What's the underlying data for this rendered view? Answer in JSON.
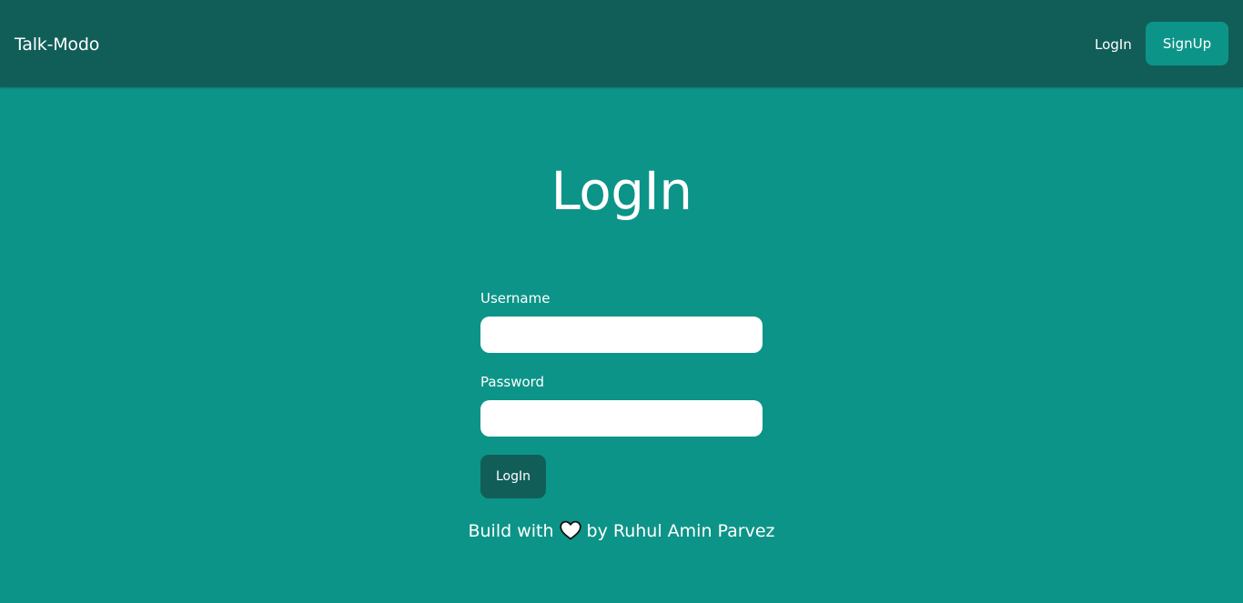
{
  "navbar": {
    "brand": "Talk-Modo",
    "login_link": "LogIn",
    "signup_button": "SignUp"
  },
  "main": {
    "title": "LogIn",
    "form": {
      "username_label": "Username",
      "username_value": "",
      "password_label": "Password",
      "password_value": "",
      "submit_label": "LogIn"
    }
  },
  "footer": {
    "prefix": "Build with",
    "icon": "heart-icon",
    "suffix": "by Ruhul Amin Parvez"
  },
  "colors": {
    "page_background": "#0d9488",
    "navbar_background": "#115e59",
    "signup_button": "#0d9488",
    "submit_button": "#115e59",
    "text": "#ffffff"
  }
}
